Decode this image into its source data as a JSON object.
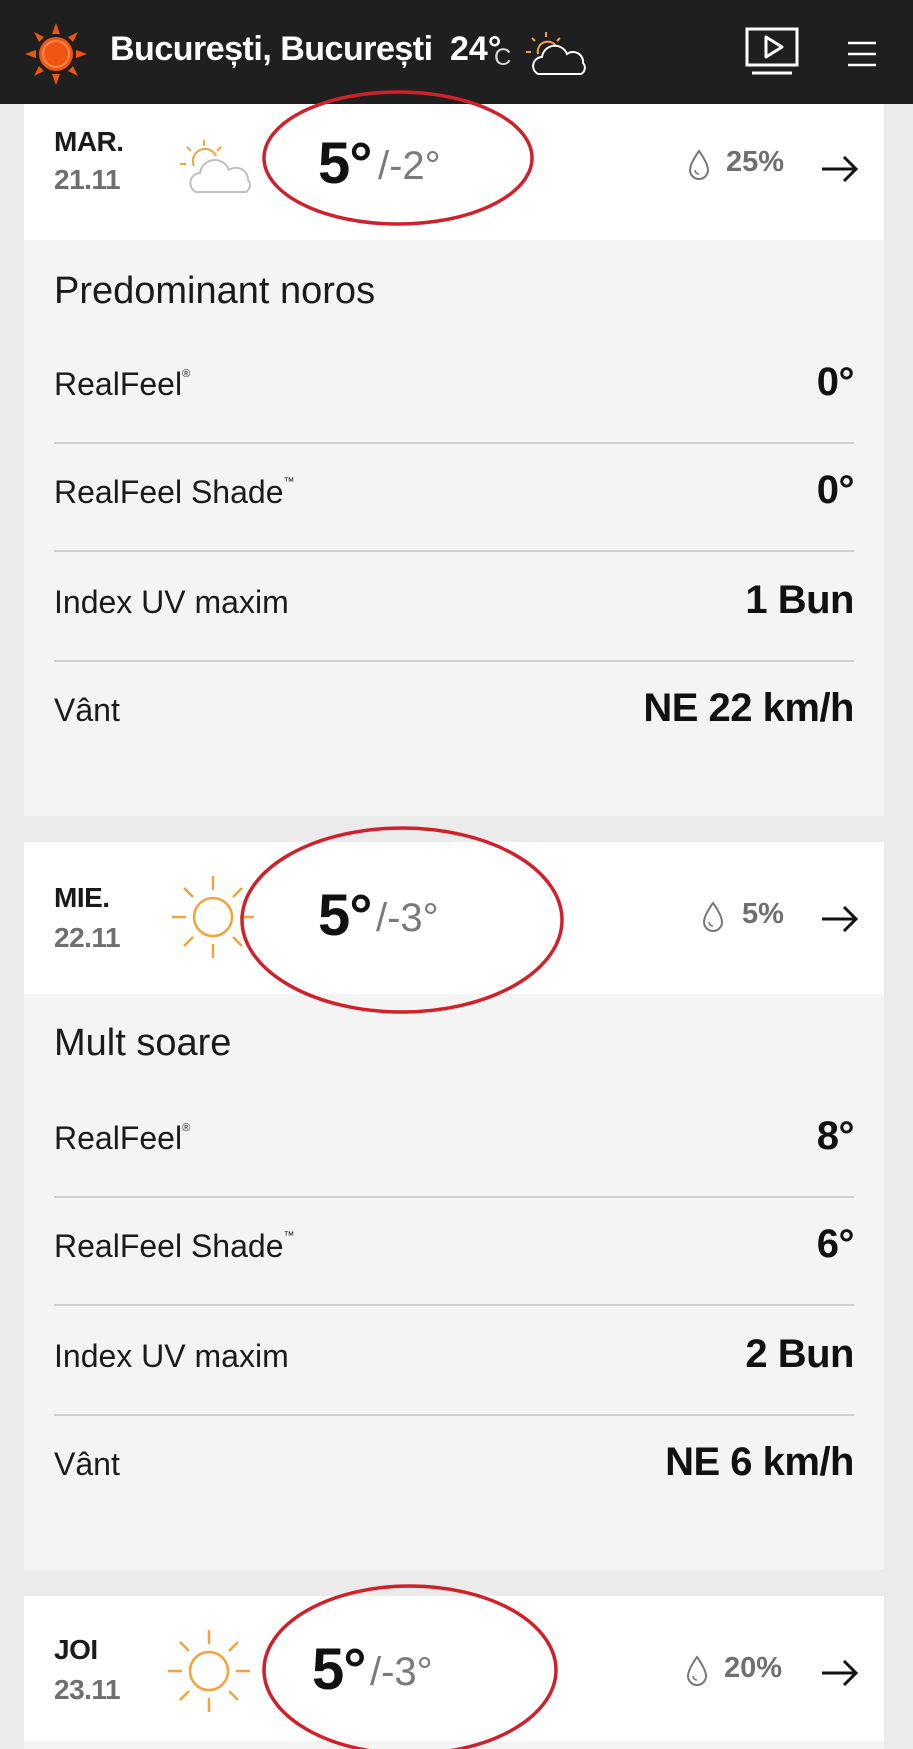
{
  "header": {
    "location": "București, București",
    "current_temp": "24°",
    "unit": "C",
    "weather_icon": "partly-cloudy-icon",
    "logo_icon": "sun-logo-icon",
    "play_icon": "video-play-icon",
    "menu_icon": "hamburger-menu-icon"
  },
  "days": [
    {
      "dow": "MAR.",
      "date": "21.11",
      "icon": "partly-cloudy-icon",
      "high": "5°",
      "low": "/-2°",
      "precip": "25%",
      "summary": "Predominant noros",
      "details": [
        {
          "label": "RealFeel",
          "mark": "®",
          "value": "0°"
        },
        {
          "label": "RealFeel Shade",
          "mark": "™",
          "value": "0°"
        },
        {
          "label": "Index UV maxim",
          "mark": "",
          "value": "1 Bun"
        },
        {
          "label": "Vânt",
          "mark": "",
          "value": "NE 22 km/h"
        }
      ]
    },
    {
      "dow": "MIE.",
      "date": "22.11",
      "icon": "sunny-icon",
      "high": "5°",
      "low": "/-3°",
      "precip": "5%",
      "summary": "Mult soare",
      "details": [
        {
          "label": "RealFeel",
          "mark": "®",
          "value": "8°"
        },
        {
          "label": "RealFeel Shade",
          "mark": "™",
          "value": "6°"
        },
        {
          "label": "Index UV maxim",
          "mark": "",
          "value": "2 Bun"
        },
        {
          "label": "Vânt",
          "mark": "",
          "value": "NE 6 km/h"
        }
      ]
    },
    {
      "dow": "JOI",
      "date": "23.11",
      "icon": "sunny-icon",
      "high": "5°",
      "low": "/-3°",
      "precip": "20%"
    }
  ],
  "colors": {
    "header_bg": "#1f1f1f",
    "accent_orange": "#f05514",
    "sun_icon": "#f4a23a",
    "annotation_red": "#d0202a"
  }
}
